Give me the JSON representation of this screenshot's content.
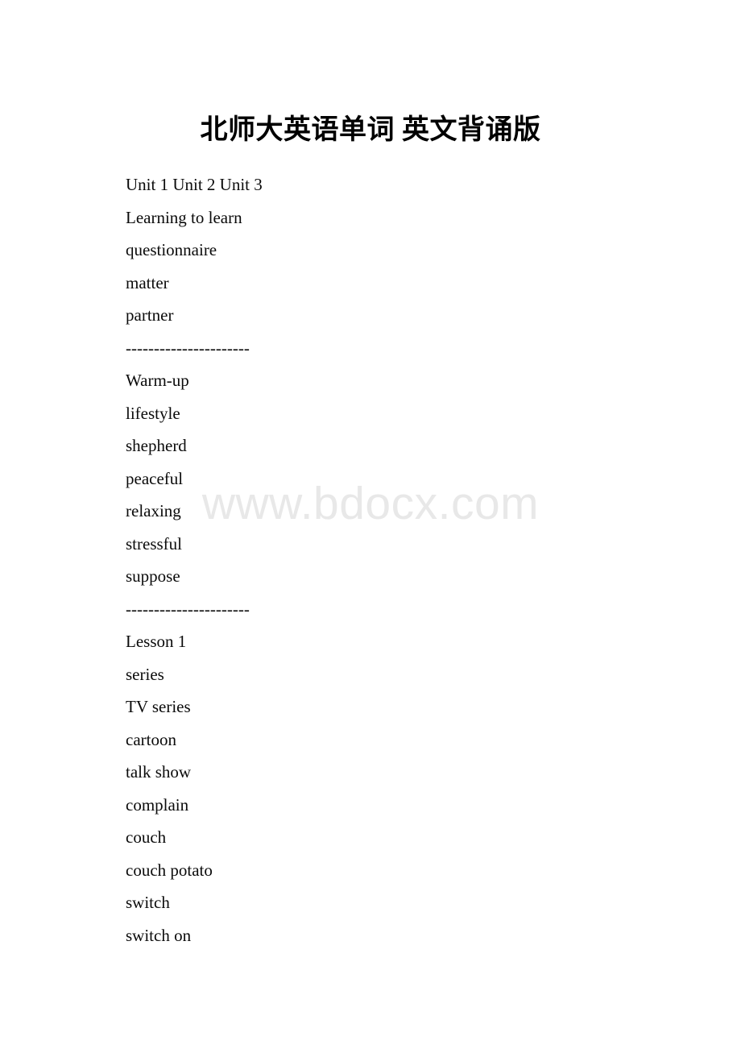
{
  "document": {
    "title": "北师大英语单词 英文背诵版",
    "watermark": "www.bdocx.com",
    "separator": "----------------------",
    "lines": [
      {
        "text": "Unit 1 Unit 2 Unit 3",
        "kind": "text"
      },
      {
        "text": "Learning to learn",
        "kind": "text"
      },
      {
        "text": "questionnaire",
        "kind": "text"
      },
      {
        "text": "matter",
        "kind": "text"
      },
      {
        "text": "partner",
        "kind": "text"
      },
      {
        "text": "----------------------",
        "kind": "separator"
      },
      {
        "text": "Warm-up",
        "kind": "text"
      },
      {
        "text": "lifestyle",
        "kind": "text"
      },
      {
        "text": "shepherd",
        "kind": "text"
      },
      {
        "text": "peaceful",
        "kind": "text"
      },
      {
        "text": "relaxing",
        "kind": "text"
      },
      {
        "text": "stressful",
        "kind": "text"
      },
      {
        "text": "suppose",
        "kind": "text"
      },
      {
        "text": "----------------------",
        "kind": "separator"
      },
      {
        "text": "Lesson 1",
        "kind": "text"
      },
      {
        "text": "series",
        "kind": "text"
      },
      {
        "text": "TV series",
        "kind": "text"
      },
      {
        "text": "cartoon",
        "kind": "text"
      },
      {
        "text": "talk show",
        "kind": "text"
      },
      {
        "text": "complain",
        "kind": "text"
      },
      {
        "text": "couch",
        "kind": "text"
      },
      {
        "text": "couch potato",
        "kind": "text"
      },
      {
        "text": "switch",
        "kind": "text"
      },
      {
        "text": "switch on",
        "kind": "text"
      }
    ],
    "colors": {
      "page_background": "#ffffff",
      "text": "#000000",
      "watermark": "#e8e8e8"
    }
  }
}
